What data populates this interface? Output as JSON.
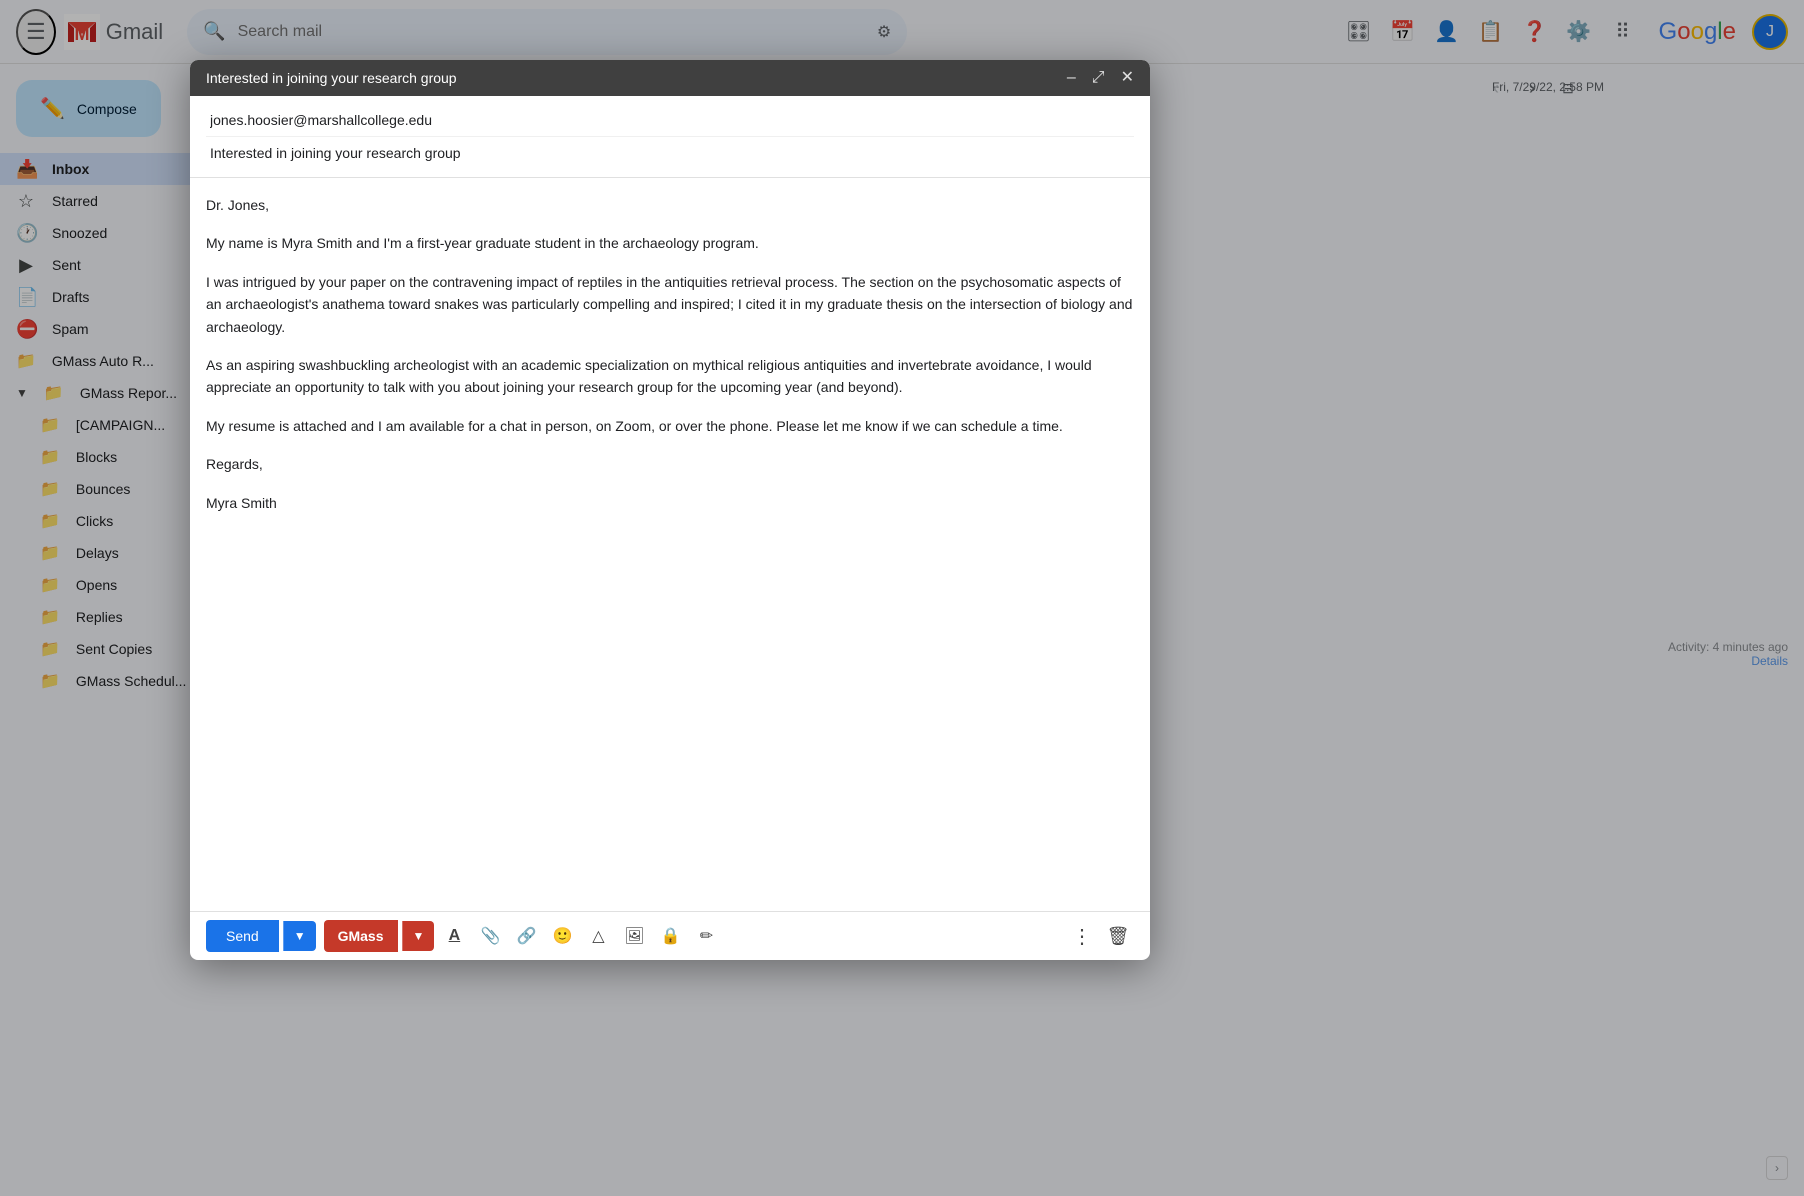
{
  "app": {
    "title": "Gmail",
    "logo_letter": "M",
    "search_placeholder": "Search mail"
  },
  "google_logo": {
    "letters": [
      "G",
      "o",
      "o",
      "g",
      "l",
      "e"
    ]
  },
  "topbar": {
    "search_placeholder": "Search mail"
  },
  "sidebar": {
    "compose_label": "Compose",
    "nav_items": [
      {
        "label": "Inbox",
        "icon": "☰",
        "active": true
      },
      {
        "label": "Starred",
        "icon": "☆",
        "active": false
      },
      {
        "label": "Snoozed",
        "icon": "⏰",
        "active": false
      },
      {
        "label": "Sent",
        "icon": "▷",
        "active": false
      },
      {
        "label": "Drafts",
        "icon": "📄",
        "active": false
      },
      {
        "label": "Spam",
        "icon": "⊘",
        "active": false
      }
    ],
    "folder_items": [
      {
        "label": "GMass Auto R...",
        "icon": "📁"
      },
      {
        "label": "GMass Repor...",
        "icon": "📁",
        "expanded": true
      }
    ],
    "sub_folders": [
      {
        "label": "[CAMPAIGN..."
      },
      {
        "label": "Blocks"
      },
      {
        "label": "Bounces"
      },
      {
        "label": "Clicks"
      },
      {
        "label": "Delays"
      },
      {
        "label": "Opens"
      },
      {
        "label": "Replies"
      },
      {
        "label": "Sent Copies"
      },
      {
        "label": "GMass Schedul..."
      }
    ]
  },
  "email_meta": {
    "date": "Fri, 7/29/22, 2:58 PM",
    "activity": "Activity: 4 minutes ago",
    "details": "Details"
  },
  "compose_modal": {
    "title": "Interested in joining your research group",
    "controls": {
      "minimize": "–",
      "expand": "⤢",
      "close": "✕"
    },
    "to_field": "jones.hoosier@marshallcollege.edu",
    "subject_field": "Interested in joining your research group",
    "body_greeting": "Dr. Jones,",
    "body_paragraphs": [
      "My name is Myra Smith and I'm a first-year graduate student in the archaeology program.",
      "I was intrigued by your paper on the contravening impact of reptiles in the antiquities retrieval process. The section on the psychosomatic aspects of an archaeologist's anathema toward snakes was particularly compelling and inspired; I cited it in my graduate thesis on the intersection of biology and archaeology.",
      "As an aspiring swashbuckling archeologist with an academic specialization on mythical religious antiquities and invertebrate avoidance, I would appreciate an opportunity to talk with you about joining your research group for the upcoming year (and beyond).",
      "My resume is attached and I am available for a chat in person, on Zoom, or over the phone. Please let me know if we can schedule a time."
    ],
    "body_closing": "Regards,",
    "body_signature": "Myra Smith",
    "toolbar": {
      "send_label": "Send",
      "gmass_label": "GMass",
      "format_text_icon": "A",
      "attach_icon": "📎",
      "link_icon": "🔗",
      "emoji_icon": "🙂",
      "drive_icon": "△",
      "photo_icon": "🖼",
      "lock_icon": "🔒",
      "pen_icon": "✏",
      "more_icon": "⋮",
      "delete_icon": "🗑"
    }
  }
}
